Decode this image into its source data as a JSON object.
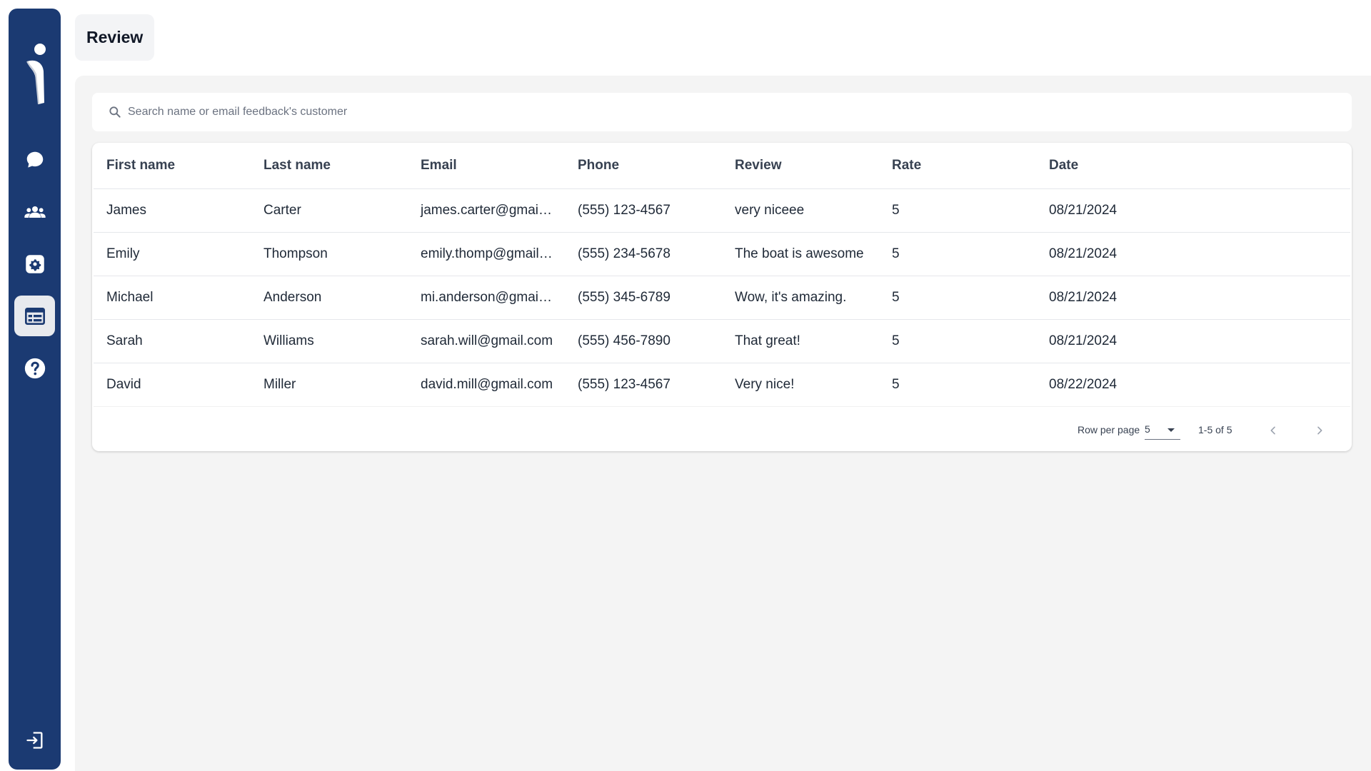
{
  "header": {
    "title": "Review"
  },
  "sidebar": {
    "items": [
      {
        "name": "chat",
        "icon": "chat-bubble-icon"
      },
      {
        "name": "users",
        "icon": "users-icon"
      },
      {
        "name": "settings",
        "icon": "gear-icon"
      },
      {
        "name": "reviews",
        "icon": "review-list-icon",
        "active": true
      },
      {
        "name": "help",
        "icon": "help-icon"
      }
    ],
    "logout_icon": "logout-icon"
  },
  "search": {
    "placeholder": "Search name or email feedback's customer",
    "value": ""
  },
  "table": {
    "columns": [
      "First name",
      "Last name",
      "Email",
      "Phone",
      "Review",
      "Rate",
      "Date"
    ],
    "rows": [
      {
        "first_name": "James",
        "last_name": "Carter",
        "email": "james.carter@gmail.com",
        "phone": "(555) 123-4567",
        "review": "very niceee",
        "rate": "5",
        "date": "08/21/2024"
      },
      {
        "first_name": "Emily",
        "last_name": "Thompson",
        "email": "emily.thomp@gmail.com",
        "phone": "(555) 234-5678",
        "review": "The boat is awesome",
        "rate": "5",
        "date": "08/21/2024"
      },
      {
        "first_name": "Michael",
        "last_name": "Anderson",
        "email": "mi.anderson@gmail.com",
        "phone": "(555) 345-6789",
        "review": "Wow, it's amazing.",
        "rate": "5",
        "date": "08/21/2024"
      },
      {
        "first_name": "Sarah",
        "last_name": "Williams",
        "email": "sarah.will@gmail.com",
        "phone": "(555) 456-7890",
        "review": "That great!",
        "rate": "5",
        "date": "08/21/2024"
      },
      {
        "first_name": "David",
        "last_name": "Miller",
        "email": "david.mill@gmail.com",
        "phone": "(555) 123-4567",
        "review": "Very nice!",
        "rate": "5",
        "date": "08/22/2024"
      }
    ]
  },
  "pagination": {
    "label": "Row per page",
    "rows_per_page": "5",
    "range": "1-5 of 5"
  },
  "colors": {
    "sidebar": "#1b3a72",
    "active_nav": "#e8eaee",
    "panel": "#f4f4f4"
  }
}
